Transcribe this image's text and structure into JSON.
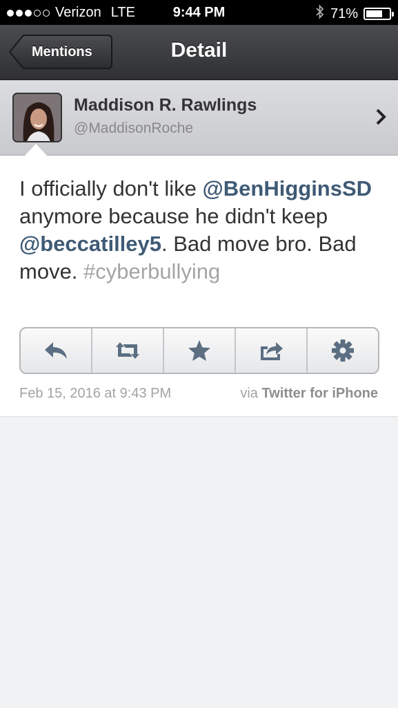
{
  "status_bar": {
    "carrier": "Verizon",
    "network": "LTE",
    "time": "9:44 PM",
    "battery": "71%",
    "battery_level": 0.71,
    "signal_bars_filled": 3,
    "signal_bars_total": 5
  },
  "nav": {
    "back_label": "Mentions",
    "title": "Detail"
  },
  "profile": {
    "name": "Maddison R. Rawlings",
    "handle": "@MaddisonRoche"
  },
  "tweet": {
    "segments": [
      {
        "type": "text",
        "text": "I officially don't like "
      },
      {
        "type": "mention",
        "text": "@BenHigginsSD"
      },
      {
        "type": "text",
        "text": " anymore because he didn't keep "
      },
      {
        "type": "mention",
        "text": "@beccatilley5"
      },
      {
        "type": "text",
        "text": ". Bad move bro. Bad move. "
      },
      {
        "type": "hashtag",
        "text": "#cyberbullying"
      }
    ],
    "date": "Feb 15, 2016 at 9:43 PM",
    "via_prefix": "via",
    "source": "Twitter for iPhone"
  },
  "actions": [
    "reply-icon",
    "retweet-icon",
    "favorite-star-icon",
    "share-icon",
    "gear-icon"
  ],
  "colors": {
    "mention": "#3f5a75",
    "hashtag": "#a4a4a4",
    "icon": "#5b6e82"
  }
}
